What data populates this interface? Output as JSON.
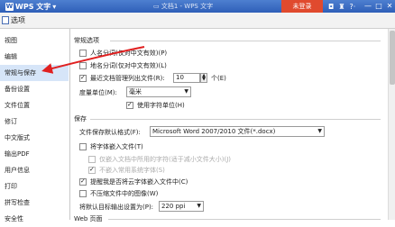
{
  "titlebar": {
    "app_name": "WPS 文字",
    "app_menu_arrow": "▾",
    "doc_title": "文档1 - WPS 文字",
    "login_label": "未登录",
    "icons": [
      "skin-icon",
      "shirt-icon",
      "help-icon"
    ],
    "help_label": "?·",
    "window_buttons": [
      "—",
      "□",
      "✕"
    ]
  },
  "dialog": {
    "title": "选项"
  },
  "sidebar": {
    "items": [
      {
        "label": "视图"
      },
      {
        "label": "编辑"
      },
      {
        "label": "常规与保存"
      },
      {
        "label": "备份设置"
      },
      {
        "label": "文件位置"
      },
      {
        "label": "修订"
      },
      {
        "label": "中文版式"
      },
      {
        "label": "输出PDF"
      },
      {
        "label": "用户信息"
      },
      {
        "label": "打印"
      },
      {
        "label": "拼写检查"
      },
      {
        "label": "安全性"
      }
    ],
    "selected_index": 2
  },
  "general": {
    "section_title": "常规选项",
    "opt1_label": "人名分词(仅对中文有效)(P)",
    "opt1_checked": false,
    "opt2_label": "地名分词(仅对中文有效)(L)",
    "opt2_checked": false,
    "recent_label": "最近文档管理列出文件(R):",
    "recent_checked": true,
    "recent_value": "10",
    "recent_unit": "个(E)",
    "unit_label": "度量单位(M):",
    "unit_value": "毫米",
    "char_unit_label": "使用字符单位(H)",
    "char_unit_checked": true
  },
  "save": {
    "section_title": "保存",
    "format_label": "文件保存默认格式(F):",
    "format_value": "Microsoft Word 2007/2010 文件(*.docx)",
    "embed_label": "将字体嵌入文件(T)",
    "embed_checked": false,
    "embed_sub1_label": "仅嵌入文档中所用的字符(适于减小文件大小)(J)",
    "embed_sub2_label": "不嵌入常用系统字体(S)",
    "embed_sub2_checked": true,
    "prompt_label": "提醒我是否将云字体嵌入文件中(C)",
    "prompt_checked": true,
    "compress_label": "不压缩文件中的图像(W)",
    "compress_checked": false,
    "dpi_label": "将默认目标输出设置为(P):",
    "dpi_value": "220 ppi"
  },
  "web": {
    "section_title": "Web 页面"
  }
}
